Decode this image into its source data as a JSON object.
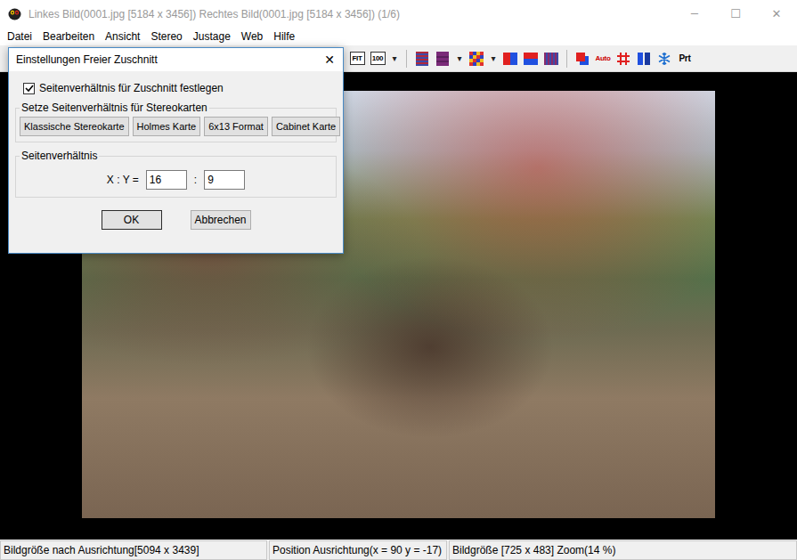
{
  "window": {
    "title": "Linkes Bild(0001.jpg [5184 x 3456]) Rechtes Bild(0001.jpg [5184 x 3456])  (1/6)",
    "controls": [
      "─",
      "☐",
      "✕"
    ]
  },
  "menu": [
    "Datei",
    "Bearbeiten",
    "Ansicht",
    "Stereo",
    "Justage",
    "Web",
    "Hilfe"
  ],
  "toolbar": [
    {
      "kind": "fit",
      "label": "FIT"
    },
    {
      "kind": "zoom",
      "label": "100"
    },
    {
      "kind": "arrow",
      "label": "▾"
    },
    {
      "kind": "sep",
      "label": ""
    },
    {
      "kind": "stripes",
      "label": ""
    },
    {
      "kind": "purple",
      "label": ""
    },
    {
      "kind": "arrow",
      "label": "▾"
    },
    {
      "kind": "checker",
      "label": ""
    },
    {
      "kind": "arrow",
      "label": "▾"
    },
    {
      "kind": "split-v",
      "label": ""
    },
    {
      "kind": "split-h",
      "label": ""
    },
    {
      "kind": "split-purple",
      "label": ""
    },
    {
      "kind": "sep",
      "label": ""
    },
    {
      "kind": "overlap",
      "label": ""
    },
    {
      "kind": "auto",
      "label": "Auto"
    },
    {
      "kind": "grid",
      "label": ""
    },
    {
      "kind": "dual",
      "label": ""
    },
    {
      "kind": "snow",
      "label": ""
    },
    {
      "kind": "print",
      "label": "Prt"
    }
  ],
  "dialog": {
    "title": "Einstellungen Freier Zuschnitt",
    "close": "✕",
    "checkbox": {
      "label": "Seitenverhältnis für Zuschnitt festlegen",
      "checked": true
    },
    "preset_group": {
      "title": "Setze Seitenverhältnis für Stereokarten",
      "buttons": [
        "Klassische Stereokarte",
        "Holmes Karte",
        "6x13 Format",
        "Cabinet Karte"
      ]
    },
    "ratio_group": {
      "title": "Seitenverhältnis",
      "label": "X : Y =",
      "x": "16",
      "separator": ":",
      "y": "9"
    },
    "buttons": [
      {
        "label": "OK",
        "default": true
      },
      {
        "label": "Abbrechen",
        "default": false
      }
    ]
  },
  "status_bar": [
    "Bildgröße nach Ausrichtung[5094 x 3439]",
    "Position Ausrichtung(x = 90 y = -17)",
    "Bildgröße [725 x 483]  Zoom(14 %)"
  ]
}
